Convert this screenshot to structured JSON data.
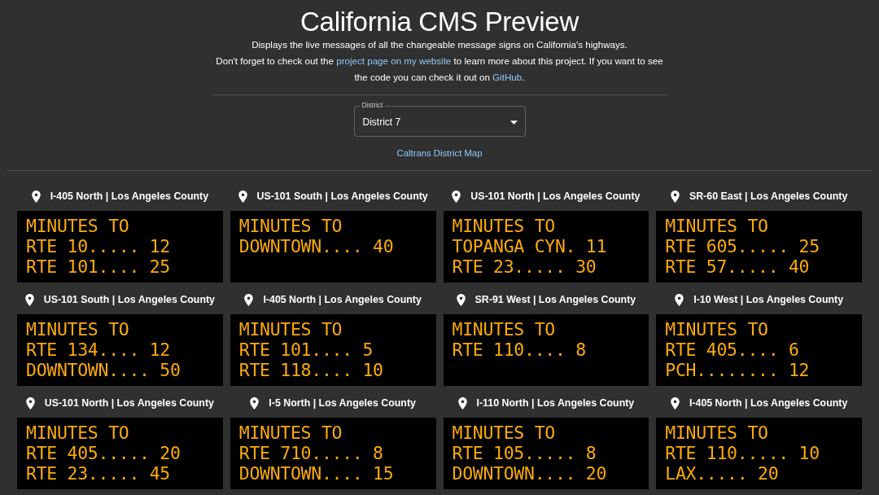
{
  "page": {
    "title": "California CMS Preview",
    "description": "Displays the live messages of all the changeable message signs on California's highways.",
    "intro": [
      {
        "kind": "text",
        "text": "Don't forget to check out the "
      },
      {
        "kind": "link",
        "text": "project page on my website"
      },
      {
        "kind": "text",
        "text": " to learn more about this project. If you want to see the code you can check it out on "
      },
      {
        "kind": "link",
        "text": "GitHub"
      },
      {
        "kind": "text",
        "text": "."
      }
    ]
  },
  "district_select": {
    "label": "District",
    "value": "District 7"
  },
  "map_link": "Caltrans District Map",
  "signs": [
    {
      "location": "I-405 North | Los Angeles County",
      "lines": [
        "MINUTES TO",
        "RTE 10..... 12",
        "RTE 101.... 25"
      ]
    },
    {
      "location": "US-101 South | Los Angeles County",
      "lines": [
        "MINUTES TO",
        "DOWNTOWN.... 40"
      ]
    },
    {
      "location": "US-101 North | Los Angeles County",
      "lines": [
        "MINUTES TO",
        "TOPANGA CYN. 11",
        "RTE 23..... 30"
      ]
    },
    {
      "location": "SR-60 East | Los Angeles County",
      "lines": [
        "MINUTES TO",
        "RTE 605..... 25",
        "RTE 57..... 40"
      ]
    },
    {
      "location": "US-101 South | Los Angeles County",
      "lines": [
        "MINUTES TO",
        "RTE 134.... 12",
        "DOWNTOWN.... 50"
      ]
    },
    {
      "location": "I-405 North | Los Angeles County",
      "lines": [
        "MINUTES TO",
        "RTE 101.... 5",
        "RTE 118.... 10"
      ]
    },
    {
      "location": "SR-91 West | Los Angeles County",
      "lines": [
        "MINUTES TO",
        "RTE 110.... 8"
      ]
    },
    {
      "location": "I-10 West | Los Angeles County",
      "lines": [
        "MINUTES TO",
        "RTE 405.... 6",
        "PCH........ 12"
      ]
    },
    {
      "location": "US-101 North | Los Angeles County",
      "lines": [
        "MINUTES TO",
        "RTE 405..... 20",
        "RTE 23..... 45"
      ]
    },
    {
      "location": "I-5 North | Los Angeles County",
      "lines": [
        "MINUTES TO",
        "RTE 710..... 8",
        "DOWNTOWN.... 15"
      ]
    },
    {
      "location": "I-110 North | Los Angeles County",
      "lines": [
        "MINUTES TO",
        "RTE 105..... 8",
        "DOWNTOWN.... 20"
      ]
    },
    {
      "location": "I-405 North | Los Angeles County",
      "lines": [
        "MINUTES TO",
        "RTE 110..... 10",
        "LAX..... 20"
      ]
    }
  ]
}
